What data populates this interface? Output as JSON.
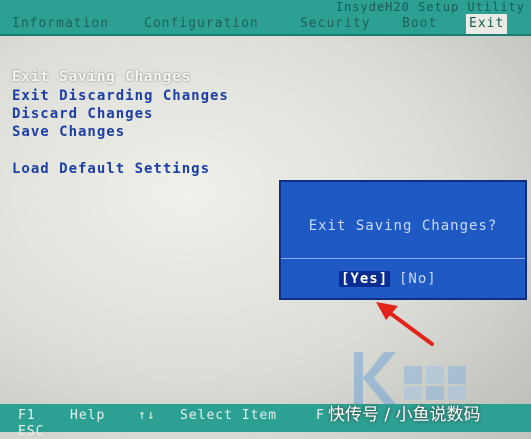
{
  "app": {
    "title": "InsydeH20 Setup Utility"
  },
  "tabs": [
    {
      "label": "Information"
    },
    {
      "label": "Configuration"
    },
    {
      "label": "Security"
    },
    {
      "label": "Boot"
    },
    {
      "label": "Exit"
    }
  ],
  "menu": [
    {
      "label": "Exit Saving Changes"
    },
    {
      "label": "Exit Discarding Changes"
    },
    {
      "label": "Discard Changes"
    },
    {
      "label": "Save Changes"
    },
    {
      "label": "Load Default Settings"
    }
  ],
  "dialog": {
    "question": "Exit Saving Changes?",
    "yes_label": "[Yes]",
    "no_label": "[No]"
  },
  "footer": {
    "key1": "F1",
    "key1_label": "Help",
    "key2": "↑↓",
    "key2_label": "Select Item",
    "key3": "F",
    "key4": "ESC"
  },
  "watermark": {
    "text": "快传号 / 小鱼说数码"
  },
  "colors": {
    "bar": "#2ca092",
    "dialog": "#1f59c4",
    "menu_text": "#1d3fa4",
    "arrow": "#e2231a"
  }
}
